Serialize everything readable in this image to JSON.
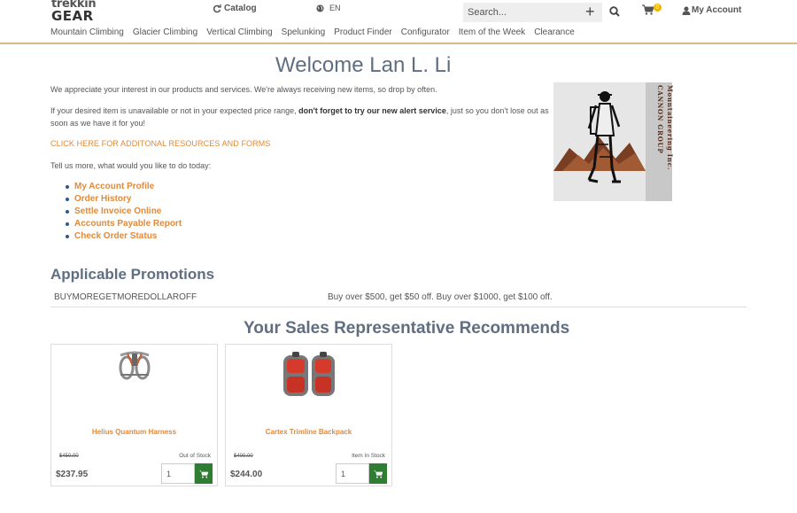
{
  "header": {
    "logo_line1": "trekkin",
    "logo_line2": "GEAR",
    "catalog_label": "Catalog",
    "language": "EN",
    "search_placeholder": "Search...",
    "cart_count": "0",
    "account_label": "My Account",
    "nav": [
      "Mountain Climbing",
      "Glacier Climbing",
      "Vertical Climbing",
      "Spelunking",
      "Product Finder",
      "Configurator",
      "Item of the Week",
      "Clearance"
    ]
  },
  "main": {
    "welcome": "Welcome Lan L. Li",
    "intro": "We appreciate your interest in our products and services. We're always receiving new items, so drop by often.",
    "alert_pre": "If your desired item is unavailable or not in your expected price range, ",
    "alert_bold": "don't forget to try our new alert service",
    "alert_post": ", just so you don't lose out as soon as we have it for you!",
    "resources_link": "CLICK HERE FOR ADDITONAL RESOURCES AND FORMS",
    "tell_us": "Tell us more, what would you like to do today:",
    "links": [
      "My Account Profile",
      "Order History",
      "Settle Invoice Online",
      "Accounts Payable Report",
      "Check Order Status"
    ],
    "mascot_text_line1": "CANNON GROUP",
    "mascot_text_line2": "Mountaineering Inc."
  },
  "promotions": {
    "title": "Applicable Promotions",
    "rows": [
      {
        "code": "BUYMOREGETMOREDOLLAROFF",
        "description": "Buy over $500, get $50 off. Buy over $1000, get $100 off."
      }
    ]
  },
  "recommendations": {
    "title": "Your Sales Representative Recommends",
    "products": [
      {
        "name": "Helius Quantum Harness",
        "old_price": "$450.00",
        "stock": "Out of Stock",
        "price": "$237.95",
        "qty": "1",
        "icon": "harness-image"
      },
      {
        "name": "Cartex Trimline Backpack",
        "old_price": "$400.00",
        "stock": "Item In Stock",
        "price": "$244.00",
        "qty": "1",
        "icon": "backpack-image"
      }
    ]
  },
  "colors": {
    "accent": "#e08a3c",
    "heading": "#5f6e80",
    "cart_button": "#2e7d32",
    "header_border": "#d7b888"
  }
}
